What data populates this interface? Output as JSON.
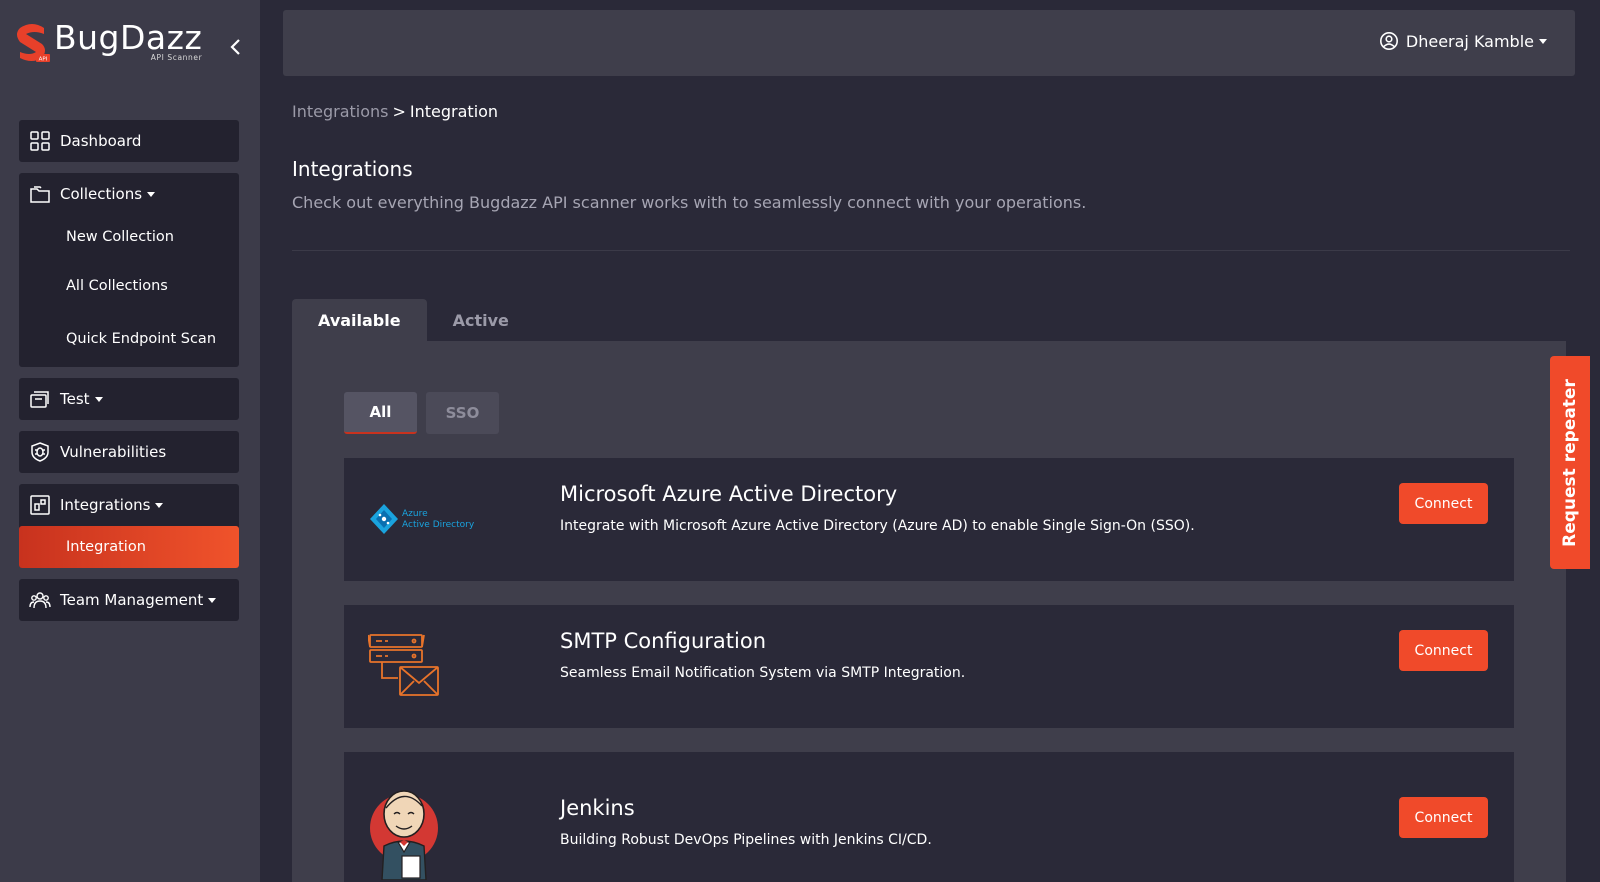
{
  "app": {
    "name": "BugDazz",
    "subtitle": "API Scanner",
    "logo_badge": "API",
    "brand_color": "#f04a2a"
  },
  "sidebar": {
    "items": [
      {
        "label": "Dashboard",
        "icon": "dashboard-grid-icon"
      },
      {
        "label": "Collections",
        "icon": "folder-icon",
        "children": [
          "New Collection",
          "All Collections",
          "Quick Endpoint Scan"
        ]
      },
      {
        "label": "Test",
        "icon": "test-folder-icon"
      },
      {
        "label": "Vulnerabilities",
        "icon": "vulnerability-bug-icon"
      },
      {
        "label": "Integrations",
        "icon": "integrations-icon",
        "children": [
          "Integration"
        ]
      },
      {
        "label": "Team Management",
        "icon": "team-icon"
      }
    ]
  },
  "header": {
    "user_name": "Dheeraj Kamble"
  },
  "breadcrumb": {
    "parent": "Integrations",
    "separator": ">",
    "current": "Integration"
  },
  "page": {
    "title": "Integrations",
    "description": "Check out everything Bugdazz API scanner works with to seamlessly connect with your operations."
  },
  "tabs": [
    "Available",
    "Active"
  ],
  "filters": [
    "All",
    "SSO"
  ],
  "integrations": [
    {
      "title": "Microsoft Azure Active Directory",
      "description": "Integrate with Microsoft Azure Active Directory (Azure AD) to enable Single Sign-On (SSO).",
      "button": "Connect",
      "logo_text_1": "Azure",
      "logo_text_2": "Active Directory"
    },
    {
      "title": "SMTP Configuration",
      "description": "Seamless Email Notification System via SMTP Integration.",
      "button": "Connect"
    },
    {
      "title": "Jenkins",
      "description": "Building Robust DevOps Pipelines with Jenkins CI/CD.",
      "button": "Connect"
    }
  ],
  "request_repeater": "Request repeater"
}
